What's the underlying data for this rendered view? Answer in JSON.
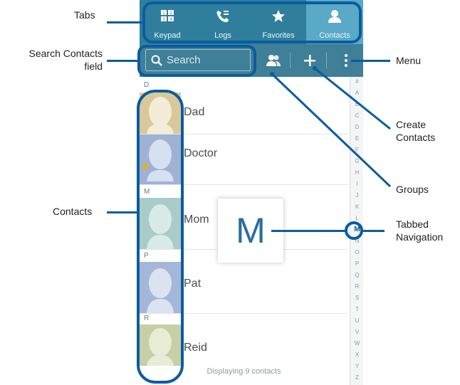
{
  "tabs": [
    {
      "label": "Keypad",
      "icon": "keypad-icon"
    },
    {
      "label": "Logs",
      "icon": "phone-log-icon"
    },
    {
      "label": "Favorites",
      "icon": "star-icon"
    },
    {
      "label": "Contacts",
      "icon": "person-icon",
      "active": true
    }
  ],
  "search": {
    "placeholder": "Search"
  },
  "index_letters": [
    "#",
    "A",
    "B",
    "C",
    "D",
    "E",
    "F",
    "G",
    "H",
    "I",
    "J",
    "K",
    "L",
    "M",
    "N",
    "O",
    "P",
    "Q",
    "R",
    "S",
    "T",
    "U",
    "V",
    "W",
    "X",
    "Y",
    "Z"
  ],
  "index_selected": "M",
  "popup_letter": "M",
  "sections": [
    {
      "header": "D",
      "contacts": [
        {
          "name": "Dad",
          "avatar_color": "#d9c99a"
        },
        {
          "name": "Doctor",
          "avatar_color": "#9fb2d4",
          "favorite": true
        }
      ]
    },
    {
      "header": "M",
      "contacts": [
        {
          "name": "Mom",
          "avatar_color": "#a9ccc8"
        }
      ]
    },
    {
      "header": "P",
      "contacts": [
        {
          "name": "Pat",
          "avatar_color": "#a5b7d8"
        }
      ]
    },
    {
      "header": "R",
      "contacts": [
        {
          "name": "Reid",
          "avatar_color": "#c6cfa5"
        }
      ]
    }
  ],
  "footer": "Displaying 9 contacts",
  "callouts": {
    "tabs": "Tabs",
    "search_field_line1": "Search Contacts",
    "search_field_line2": "field",
    "menu": "Menu",
    "create_line1": "Create",
    "create_line2": "Contacts",
    "groups": "Groups",
    "contacts": "Contacts",
    "tabbed_line1": "Tabbed",
    "tabbed_line2": "Navigation"
  },
  "colors": {
    "tabbar": "#2f7f9c",
    "actionbar": "#3f7f97",
    "annotation": "#0b5c9e",
    "accent_letter": "#2a6f9a"
  }
}
